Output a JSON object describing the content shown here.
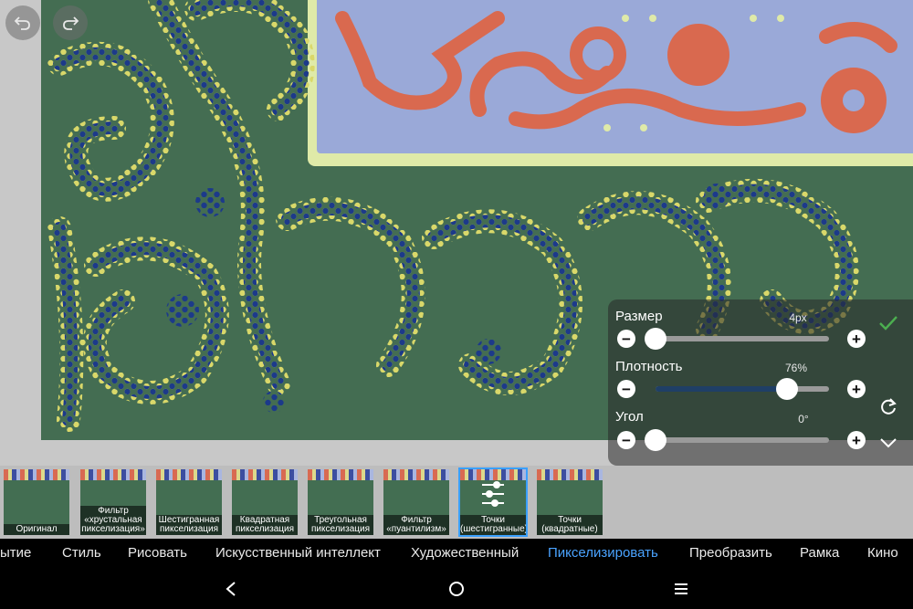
{
  "toolbar": {
    "undo_icon": "undo-icon",
    "redo_icon": "redo-icon"
  },
  "photo": {
    "description_icon": "pixelated-ornament-image"
  },
  "panel": {
    "size": {
      "label": "Размер",
      "value": "4px",
      "fraction": 0.0
    },
    "density": {
      "label": "Плотность",
      "value": "76%",
      "fraction": 0.76
    },
    "angle": {
      "label": "Угол",
      "value": "0°",
      "fraction": 0.0
    },
    "minus_symbol": "−",
    "plus_symbol": "+",
    "accent_color": "#4caf50"
  },
  "filters": [
    {
      "caption": "Оригинал",
      "selected": false
    },
    {
      "caption": "Фильтр «хрустальная пикселизация»",
      "selected": false
    },
    {
      "caption": "Шестигранная пикселизация",
      "selected": false
    },
    {
      "caption": "Квадратная пикселизация",
      "selected": false
    },
    {
      "caption": "Треугольная пикселизация",
      "selected": false
    },
    {
      "caption": "Фильтр «пуантилизм»",
      "selected": false
    },
    {
      "caption": "Точки (шестигранные)",
      "selected": true
    },
    {
      "caption": "Точки (квадратные)",
      "selected": false
    }
  ],
  "categories": [
    {
      "label": "ытие",
      "active": false
    },
    {
      "label": "Стиль",
      "active": false
    },
    {
      "label": "Рисовать",
      "active": false
    },
    {
      "label": "Искусственный интеллект",
      "active": false
    },
    {
      "label": "Художественный",
      "active": false
    },
    {
      "label": "Пикселизировать",
      "active": true
    },
    {
      "label": "Преобразить",
      "active": false
    },
    {
      "label": "Рамка",
      "active": false
    },
    {
      "label": "Кино",
      "active": false
    }
  ],
  "colors": {
    "selected_accent": "#3aa0ff",
    "active_category": "#4aa3ff"
  }
}
